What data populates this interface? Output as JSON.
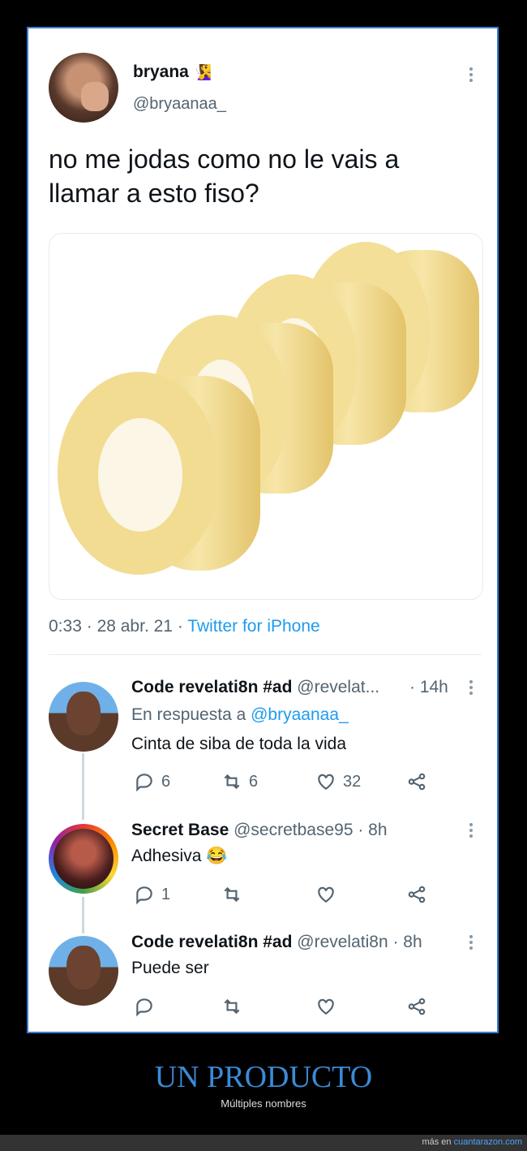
{
  "tweet": {
    "author_name": "bryana",
    "author_emoji": "🧏‍♀️",
    "handle": "@bryaanaa_",
    "text_line1": "no me jodas como no le vais a",
    "text_line2": "llamar a esto fiso?",
    "time": "0:33",
    "date": "28 abr. 21",
    "source": "Twitter for iPhone"
  },
  "replies": [
    {
      "name": "Code revelati8n #ad",
      "handle": "@revelat...",
      "time": "· 14h",
      "reply_to_prefix": "En respuesta a",
      "reply_to_handle": "@bryaanaa_",
      "text": "Cinta de siba de toda la vida",
      "comments": "6",
      "retweets": "6",
      "likes": "32"
    },
    {
      "name": "Secret Base",
      "handle": "@secretbase95 · 8h",
      "text": "Adhesiva 😂",
      "comments": "1"
    },
    {
      "name": "Code revelati8n #ad",
      "handle": "@revelati8n · 8h",
      "text": "Puede ser"
    }
  ],
  "footer": {
    "title": "UN PRODUCTO",
    "subtitle": "Múltiples nombres",
    "credit_prefix": "más en",
    "credit_site": "cuantarazon.com"
  },
  "colors": {
    "accent": "#1d9bf0",
    "footer_title": "#3a8bd6",
    "frame_border": "#3a7bd5"
  },
  "icons": [
    "more-icon",
    "comment-icon",
    "retweet-icon",
    "like-icon",
    "share-icon"
  ]
}
